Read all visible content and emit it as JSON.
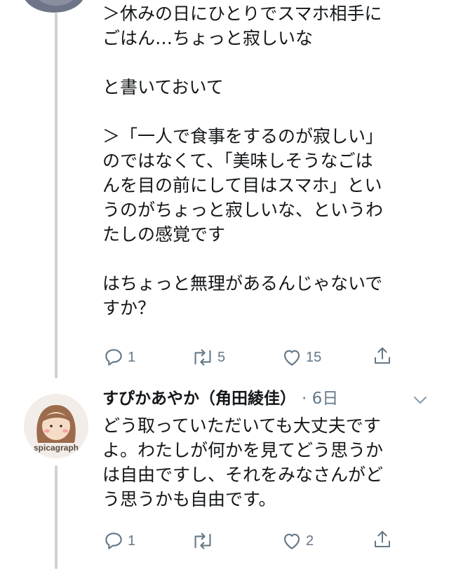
{
  "tweet1": {
    "text": "＞休みの日にひとりでスマホ相手に\nごはん…ちょっと寂しいな\n\nと書いておいて\n\n＞「一人で食事をするのが寂しい」\nのではなくて、「美味しそうなごは\nんを目の前にして目はスマホ」とい\nうのがちょっと寂しいな、というわ\nたしの感覚です\n\nはちょっと無理があるんじゃないで\nすか？",
    "reply_count": "1",
    "retweet_count": "5",
    "like_count": "15"
  },
  "tweet2": {
    "author_name": "すぴかあやか（角田綾佳）",
    "time": "· 6日",
    "avatar_label": "spicagraph",
    "text": "どう取っていただいても大丈夫です\nよ。わたしが何かを見てどう思うか\nは自由ですし、それをみなさんがど\nう思うかも自由です。",
    "reply_count": "1",
    "retweet_count": "",
    "like_count": "2"
  },
  "icons": {
    "reply": "reply-icon",
    "retweet": "retweet-icon",
    "like": "heart-icon",
    "share": "share-icon",
    "caret": "chevron-down-icon"
  },
  "colors": {
    "text": "#14171a",
    "secondary": "#657786",
    "thread_line": "#cdd2d6"
  }
}
